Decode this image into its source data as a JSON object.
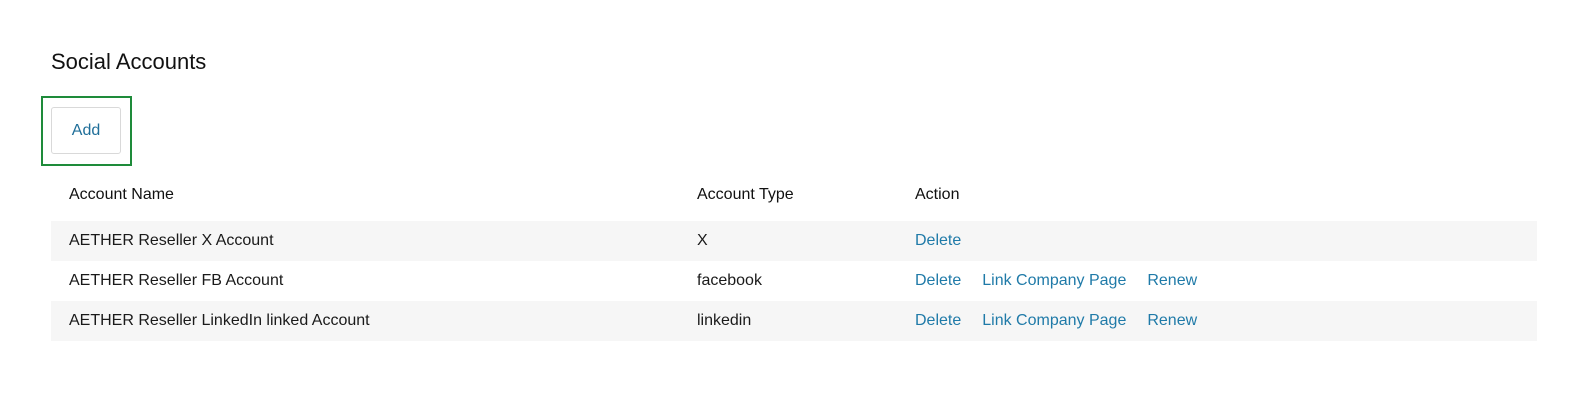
{
  "page": {
    "title": "Social Accounts",
    "add_button_label": "Add"
  },
  "table": {
    "headers": {
      "name": "Account Name",
      "type": "Account Type",
      "action": "Action"
    },
    "rows": [
      {
        "name": "AETHER Reseller X Account",
        "type": "X",
        "actions": [
          "Delete"
        ]
      },
      {
        "name": "AETHER Reseller FB Account",
        "type": "facebook",
        "actions": [
          "Delete",
          "Link Company Page",
          "Renew"
        ]
      },
      {
        "name": "AETHER Reseller LinkedIn linked Account",
        "type": "linkedin",
        "actions": [
          "Delete",
          "Link Company Page",
          "Renew"
        ]
      }
    ]
  },
  "colors": {
    "link": "#1f7aa8",
    "highlight_border": "#1e8b3a",
    "stripe": "#f6f6f6"
  }
}
